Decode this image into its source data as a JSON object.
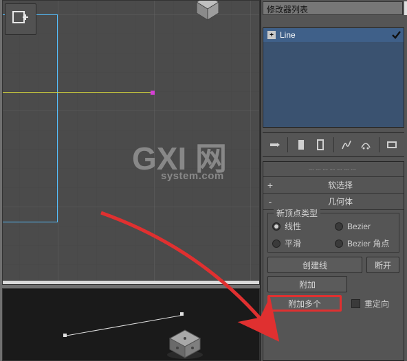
{
  "panel": {
    "modifier_list_label": "修改器列表",
    "modifier_stack": {
      "item": "Line"
    },
    "rollouts": {
      "soft_selection": "软选择",
      "geometry": "几何体"
    },
    "new_vertex_type": {
      "title": "新顶点类型",
      "linear": "线性",
      "bezier": "Bezier",
      "smooth": "平滑",
      "bezier_corner": "Bezier 角点"
    },
    "buttons": {
      "create_line": "创建线",
      "break": "断开",
      "attach": "附加",
      "attach_multiple": "附加多个",
      "reorient": "重定向"
    }
  },
  "watermark": {
    "big": "GXI 网",
    "small": "system.com"
  },
  "icons": {
    "app_logo": "app-logo-icon",
    "pin": "pin-icon",
    "stack1": "stack-icon",
    "stack2": "stack-hollow-icon",
    "curve1": "curve-icon",
    "curve2": "curve2-icon",
    "config": "configure-icon",
    "plus": "plus-icon",
    "check": "check-icon"
  }
}
